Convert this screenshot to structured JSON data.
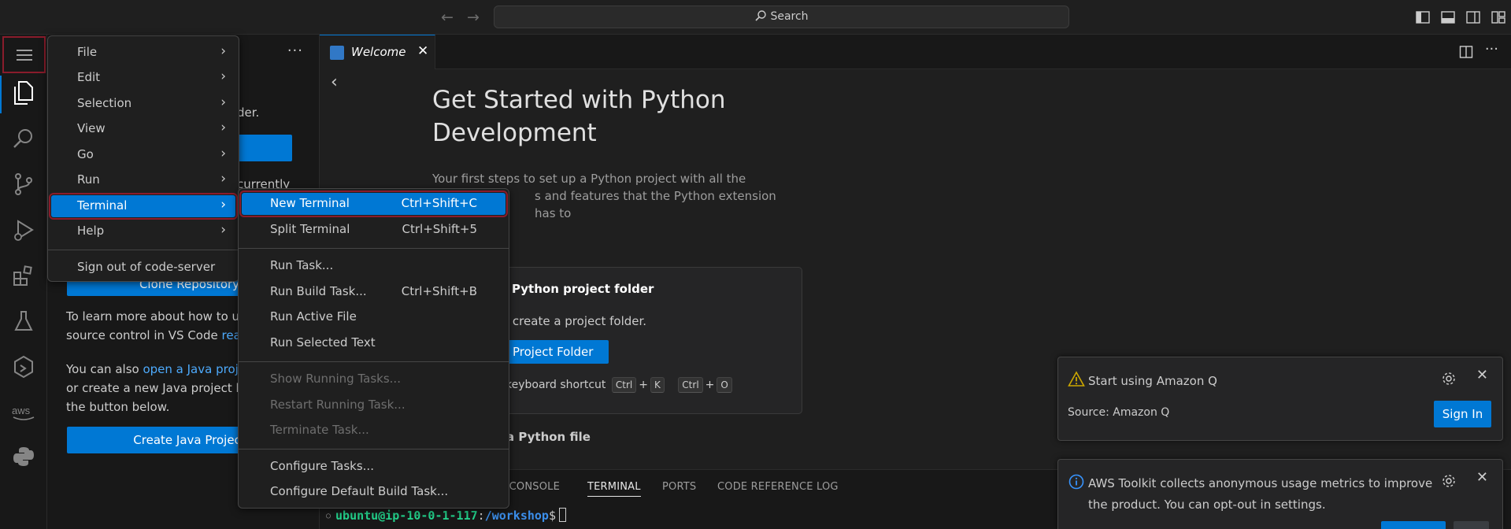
{
  "titlebar": {
    "search_placeholder": "Search"
  },
  "sidebar": {
    "line_older": "der.",
    "line_currently": "currently",
    "clone_button": "Clone Repository",
    "learn_line1": "To learn more about how to us",
    "learn_line2_pre": "source control in VS Code ",
    "learn_line2_link": "read",
    "java_line1_pre": "You can also ",
    "java_line1_link": "open a Java proje",
    "java_line2": "or create a new Java project by",
    "java_line3": "the button below.",
    "create_java_button": "Create Java Project"
  },
  "editor": {
    "tab_label": "Welcome",
    "title": "Get Started with Python Development",
    "desc_line1": "Your first steps to set up a Python project with all the",
    "desc_line2": "s and features that the Python extension has to",
    "step1_title": "Python project folder",
    "step1_desc": "r create a project folder.",
    "step1_button": "Project Folder",
    "step1_shortcut_label": "keyboard shortcut",
    "kbd_ctrl": "Ctrl",
    "kbd_plus": "+",
    "kbd_k": "K",
    "kbd_o": "O",
    "step2_title": "a Python file"
  },
  "panel": {
    "tabs": [
      "G CONSOLE",
      "TERMINAL",
      "PORTS",
      "CODE REFERENCE LOG"
    ],
    "terminal_user": "ubuntu@ip-10-0-1-117",
    "terminal_sep": ":",
    "terminal_path": "/workshop",
    "terminal_prompt": "$"
  },
  "main_menu": {
    "items": [
      {
        "label": "File"
      },
      {
        "label": "Edit"
      },
      {
        "label": "Selection"
      },
      {
        "label": "View"
      },
      {
        "label": "Go"
      },
      {
        "label": "Run"
      },
      {
        "label": "Terminal"
      },
      {
        "label": "Help"
      }
    ],
    "sign_out": "Sign out of code-server"
  },
  "terminal_menu": {
    "group1": [
      {
        "label": "New Terminal",
        "shortcut": "Ctrl+Shift+C"
      },
      {
        "label": "Split Terminal",
        "shortcut": "Ctrl+Shift+5"
      }
    ],
    "group2": [
      {
        "label": "Run Task...",
        "shortcut": ""
      },
      {
        "label": "Run Build Task...",
        "shortcut": "Ctrl+Shift+B"
      },
      {
        "label": "Run Active File",
        "shortcut": ""
      },
      {
        "label": "Run Selected Text",
        "shortcut": ""
      }
    ],
    "group3": [
      {
        "label": "Show Running Tasks..."
      },
      {
        "label": "Restart Running Task..."
      },
      {
        "label": "Terminate Task..."
      }
    ],
    "group4": [
      {
        "label": "Configure Tasks..."
      },
      {
        "label": "Configure Default Build Task..."
      }
    ]
  },
  "notifications": {
    "amazon_q": {
      "message": "Start using Amazon Q",
      "source": "Source: Amazon Q",
      "button": "Sign In"
    },
    "aws_toolkit": {
      "message": "AWS Toolkit collects anonymous usage metrics to improve the product. You can opt-out in settings."
    }
  },
  "colors": {
    "accent": "#0078d4",
    "highlight_outline": "#8a1c2b",
    "terminal_user": "#23d18b",
    "terminal_path": "#3b8eea",
    "warning": "#cca700",
    "info": "#3794ff"
  }
}
